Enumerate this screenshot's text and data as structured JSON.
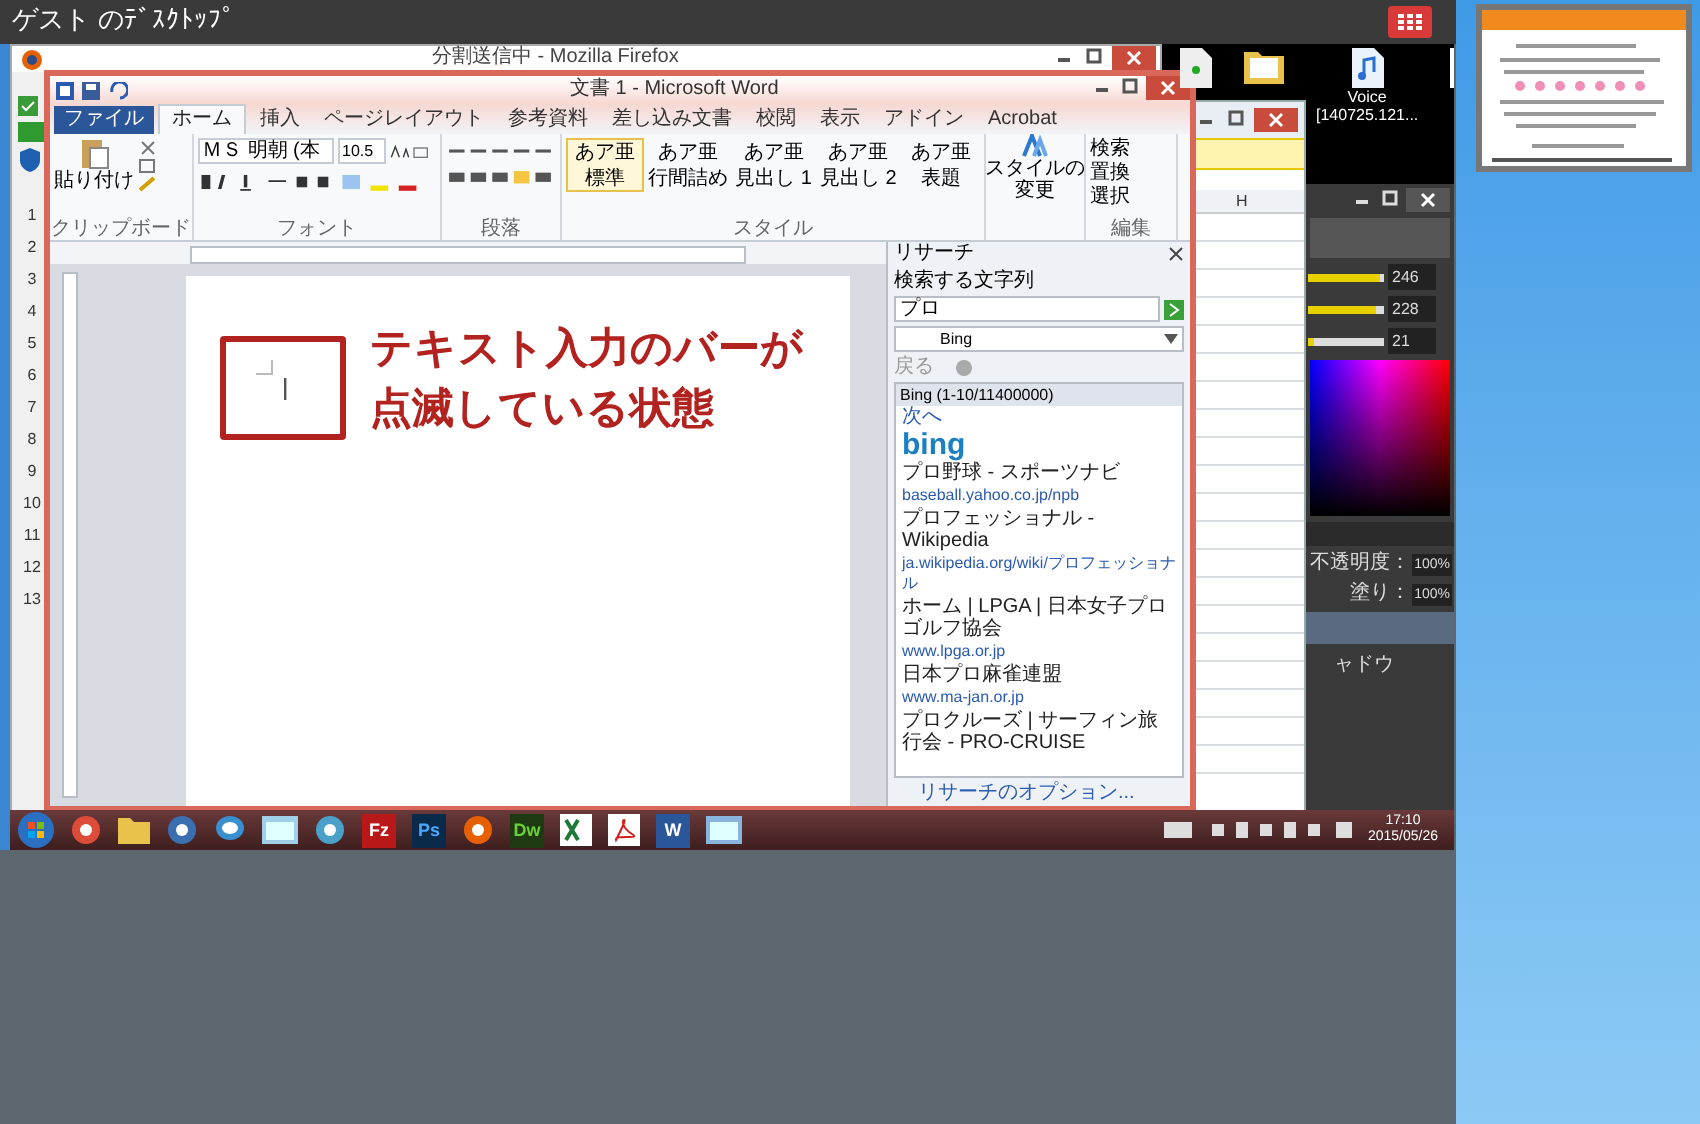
{
  "viewer": {
    "title": "ゲスト のﾃﾞｽｸﾄｯﾌﾟ"
  },
  "firefox": {
    "title": "分割送信中 - Mozilla Firefox"
  },
  "row_numbers": [
    "1",
    "2",
    "3",
    "4",
    "5",
    "6",
    "7",
    "8",
    "9",
    "10",
    "11",
    "12",
    "13"
  ],
  "desktop_icons": [
    {
      "kind": "file"
    },
    {
      "kind": "folder"
    },
    {
      "kind": "audio",
      "lines": [
        "Voice",
        "[140725.121..."
      ]
    },
    {
      "kind": "document"
    }
  ],
  "excel": {
    "column": "H"
  },
  "photoshop": {
    "sliders": [
      {
        "level": 0.96,
        "reading": "246"
      },
      {
        "level": 0.89,
        "reading": "228"
      },
      {
        "level": 0.08,
        "reading": "21"
      }
    ],
    "opacity_label": "不透明度：",
    "opacity": "100%",
    "fill_label": "塗り：",
    "fill": "100%",
    "layer": "ャドウ"
  },
  "word": {
    "title": "文書 1 - Microsoft Word",
    "tabs": [
      {
        "label": "ファイル",
        "kind": "file",
        "selected": false
      },
      {
        "label": "ホーム",
        "kind": "tab",
        "selected": true
      },
      {
        "label": "挿入",
        "kind": "tab",
        "selected": false
      },
      {
        "label": "ページレイアウト",
        "kind": "tab",
        "selected": false
      },
      {
        "label": "参考資料",
        "kind": "tab",
        "selected": false
      },
      {
        "label": "差し込み文書",
        "kind": "tab",
        "selected": false
      },
      {
        "label": "校閲",
        "kind": "tab",
        "selected": false
      },
      {
        "label": "表示",
        "kind": "tab",
        "selected": false
      },
      {
        "label": "アドイン",
        "kind": "tab",
        "selected": false
      },
      {
        "label": "Acrobat",
        "kind": "tab",
        "selected": false
      }
    ],
    "clipboard": {
      "paste": "貼り付け",
      "group": "クリップボード"
    },
    "font": {
      "name": "ＭＳ 明朝 (本",
      "size": "10.5",
      "group": "フォント"
    },
    "paragraph": {
      "group": "段落"
    },
    "styles": {
      "items": [
        {
          "sample": "あア亜",
          "label": "標準",
          "selected": true
        },
        {
          "sample": "あア亜",
          "label": "行間詰め",
          "selected": false
        },
        {
          "sample": "あア亜",
          "label": "見出し 1",
          "selected": false
        },
        {
          "sample": "あア亜",
          "label": "見出し 2",
          "selected": false
        },
        {
          "sample": "あア亜",
          "label": "表題",
          "selected": false
        }
      ],
      "change": "スタイルの変更",
      "group": "スタイル"
    },
    "editing": {
      "items": [
        "検索",
        "置換",
        "選択"
      ],
      "group": "編集"
    },
    "annotation": {
      "lines": [
        "テキスト入力のバーが",
        "点滅している状態"
      ]
    },
    "research": {
      "title": "リサーチ",
      "query_label": "検索する文字列",
      "query": "プロ",
      "source": "Bing",
      "back": "戻る",
      "results_header": "Bing (1-10/11400000)",
      "next": "次へ",
      "logo": "bing",
      "results": [
        {
          "title": "プロ野球 - スポーツナビ",
          "url": "baseball.yahoo.co.jp/npb"
        },
        {
          "title": "プロフェッショナル - Wikipedia",
          "url": "ja.wikipedia.org/wiki/プロフェッショナル"
        },
        {
          "title": "ホーム | LPGA | 日本女子プロゴルフ協会",
          "url": "www.lpga.or.jp"
        },
        {
          "title": "日本プロ麻雀連盟",
          "url": "www.ma-jan.or.jp"
        },
        {
          "title": "プロクルーズ | サーフィン旅行会 - PRO-CRUISE"
        }
      ],
      "options": "リサーチのオプション..."
    }
  },
  "taskbar": {
    "apps": [
      {
        "kind": "start"
      },
      {
        "kind": "chrome"
      },
      {
        "kind": "folder"
      },
      {
        "kind": "mail"
      },
      {
        "kind": "chat"
      },
      {
        "kind": "photos"
      },
      {
        "kind": "network"
      },
      {
        "kind": "filezilla",
        "label": "Fz"
      },
      {
        "kind": "photoshop",
        "label": "Ps"
      },
      {
        "kind": "firefox"
      },
      {
        "kind": "dreamweaver",
        "label": "Dw"
      },
      {
        "kind": "excel"
      },
      {
        "kind": "acrobat"
      },
      {
        "kind": "word",
        "label": "W"
      },
      {
        "kind": "window"
      }
    ],
    "time": "17:10",
    "date": "2015/05/26"
  }
}
